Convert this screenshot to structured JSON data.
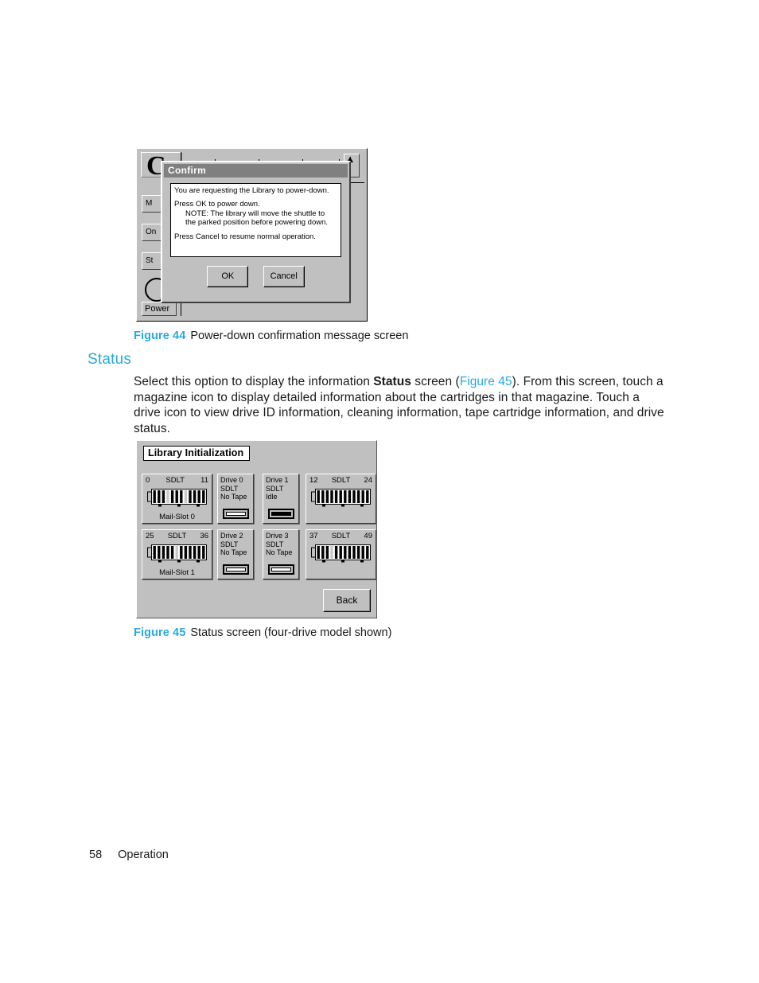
{
  "page": {
    "number": "58",
    "section_label": "Operation"
  },
  "section": {
    "heading": "Status",
    "body_before_bold": "Select this option to display the information ",
    "body_bold": "Status",
    "body_after_bold": " screen (",
    "body_link": "Figure 45",
    "body_rest": "). From this screen, touch a magazine icon to display detailed information about the cartridges in that magazine. Touch a drive icon to view drive ID information, cleaning information, tape cartridge information, and drive status."
  },
  "figure44": {
    "caption_number": "Figure 44",
    "caption_text": "Power-down confirmation message screen",
    "background_window": {
      "logo_glyph": "C",
      "menu_buttons": [
        "M",
        "On",
        "St"
      ],
      "power_button": "Power",
      "scroll_up_icon": "up-arrow-icon"
    },
    "dialog": {
      "title": "Confirm",
      "line1": "You are requesting the Library to power-down.",
      "line2": "Press OK to power down.",
      "line3": "NOTE: The library will move the shuttle to",
      "line4": "the parked position before powering down.",
      "line5": "Press Cancel to resume normal operation.",
      "ok_label": "OK",
      "cancel_label": "Cancel"
    }
  },
  "figure45": {
    "caption_number": "Figure 45",
    "caption_text": "Status screen (four-drive model shown)",
    "screen_title": "Library Initialization",
    "back_label": "Back",
    "magazines": [
      {
        "start_slot": "0",
        "media_type": "SDLT",
        "end_slot": "11",
        "footer": "Mail-Slot 0",
        "cartridge_pattern": [
          1,
          1,
          1,
          0,
          1,
          1,
          1,
          0,
          1,
          1,
          1,
          1
        ]
      },
      {
        "start_slot": "12",
        "media_type": "SDLT",
        "end_slot": "24",
        "footer": "",
        "cartridge_pattern": [
          1,
          1,
          1,
          1,
          1,
          1,
          1,
          1,
          1,
          1,
          1,
          1
        ]
      },
      {
        "start_slot": "25",
        "media_type": "SDLT",
        "end_slot": "36",
        "footer": "Mail-Slot 1",
        "cartridge_pattern": [
          1,
          1,
          1,
          1,
          1,
          0,
          1,
          1,
          1,
          1,
          1,
          1
        ]
      },
      {
        "start_slot": "37",
        "media_type": "SDLT",
        "end_slot": "49",
        "footer": "",
        "cartridge_pattern": [
          1,
          1,
          1,
          0,
          1,
          1,
          1,
          1,
          1,
          1,
          1,
          1
        ]
      }
    ],
    "drives": [
      {
        "name": "Drive 0",
        "media_type": "SDLT",
        "state": "No Tape",
        "loaded": false
      },
      {
        "name": "Drive 1",
        "media_type": "SDLT",
        "state": "Idle",
        "loaded": true
      },
      {
        "name": "Drive 2",
        "media_type": "SDLT",
        "state": "No Tape",
        "loaded": false
      },
      {
        "name": "Drive 3",
        "media_type": "SDLT",
        "state": "No Tape",
        "loaded": false
      }
    ]
  },
  "colors": {
    "accent": "#29a9e0",
    "panel": "#c0c0c0",
    "titlebar": "#808080",
    "text": "#1a1a1a"
  }
}
